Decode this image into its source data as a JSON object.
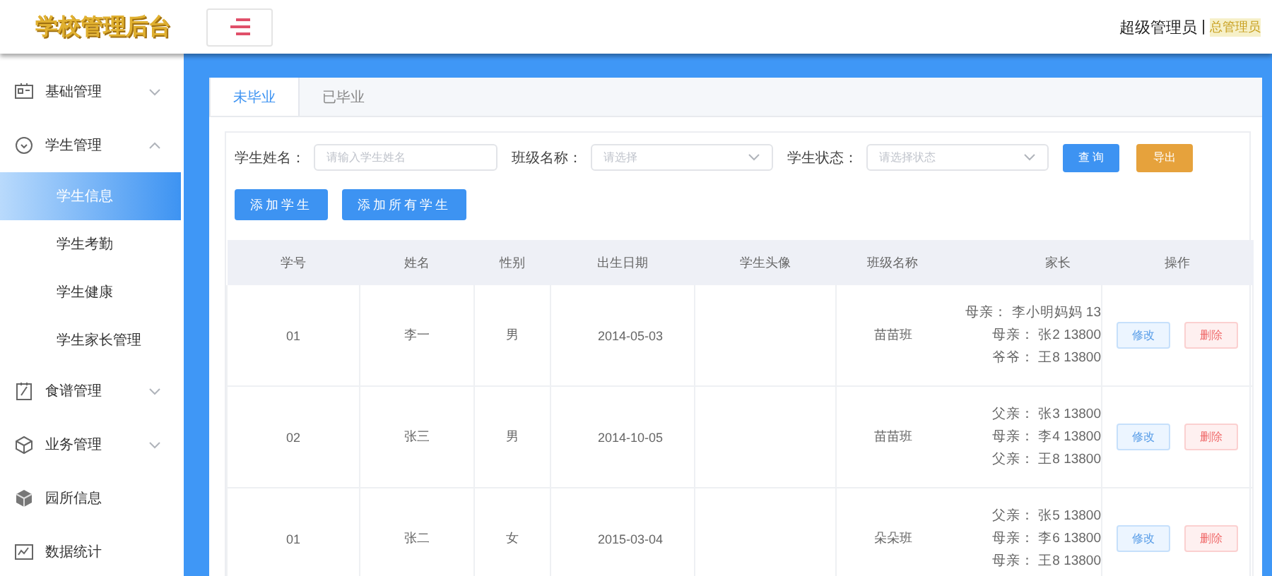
{
  "header": {
    "logo": "学校管理后台",
    "user_role": "超级管理员",
    "separator": "|",
    "user_name": "总管理员"
  },
  "sidebar": {
    "items": [
      {
        "label": "基础管理",
        "kind": "group",
        "expanded": false
      },
      {
        "label": "学生管理",
        "kind": "group",
        "expanded": true,
        "children": [
          {
            "label": "学生信息",
            "selected": true
          },
          {
            "label": "学生考勤",
            "selected": false
          },
          {
            "label": "学生健康",
            "selected": false
          },
          {
            "label": "学生家长管理",
            "selected": false
          }
        ]
      },
      {
        "label": "食谱管理",
        "kind": "group",
        "expanded": false
      },
      {
        "label": "业务管理",
        "kind": "group",
        "expanded": false
      },
      {
        "label": "园所信息",
        "kind": "link"
      },
      {
        "label": "数据统计",
        "kind": "link"
      }
    ]
  },
  "tabs": [
    {
      "label": "未毕业",
      "selected": true
    },
    {
      "label": "已毕业",
      "selected": false
    }
  ],
  "filters": [
    {
      "kind": "text",
      "label": "学生姓名：",
      "placeholder": "请输入学生姓名"
    },
    {
      "kind": "select",
      "label": "班级名称：",
      "placeholder": "请选择"
    },
    {
      "kind": "select",
      "label": "学生状态：",
      "placeholder": "请选择状态"
    }
  ],
  "filter_buttons": [
    {
      "label": "查 询",
      "kind": "primary"
    },
    {
      "label": "导出",
      "kind": "warning"
    }
  ],
  "add_buttons": [
    {
      "label": "添加学生",
      "kind": "primary"
    },
    {
      "label": "添加所有学生",
      "kind": "primary"
    }
  ],
  "table": {
    "columns": [
      "学号",
      "姓名",
      "性别",
      "出生日期",
      "学生头像",
      "班级名称",
      "家长",
      "操作"
    ],
    "rows": [
      {
        "id": "01",
        "name": "李一",
        "gender": "男",
        "birth_date": "2014-05-03",
        "class_name": "苗苗班",
        "parents": [
          "母亲： 李小明妈妈 13",
          "母亲： 张2 13800",
          "爷爷： 王8 13800"
        ],
        "actions": [
          {
            "label": "修改",
            "kind": "edit"
          },
          {
            "label": "删除",
            "kind": "delete"
          }
        ]
      },
      {
        "id": "02",
        "name": "张三",
        "gender": "男",
        "birth_date": "2014-10-05",
        "class_name": "苗苗班",
        "parents": [
          "父亲： 张3 13800",
          "母亲： 李4 13800",
          "父亲： 王8 13800"
        ],
        "actions": [
          {
            "label": "修改",
            "kind": "edit"
          },
          {
            "label": "删除",
            "kind": "delete"
          }
        ]
      },
      {
        "id": "01",
        "name": "张二",
        "gender": "女",
        "birth_date": "2015-03-04",
        "class_name": "朵朵班",
        "parents": [
          "父亲： 张5 13800",
          "母亲： 李6 13800",
          "母亲： 王8 13800"
        ],
        "actions": [
          {
            "label": "修改",
            "kind": "edit"
          },
          {
            "label": "删除",
            "kind": "delete"
          }
        ]
      }
    ]
  }
}
